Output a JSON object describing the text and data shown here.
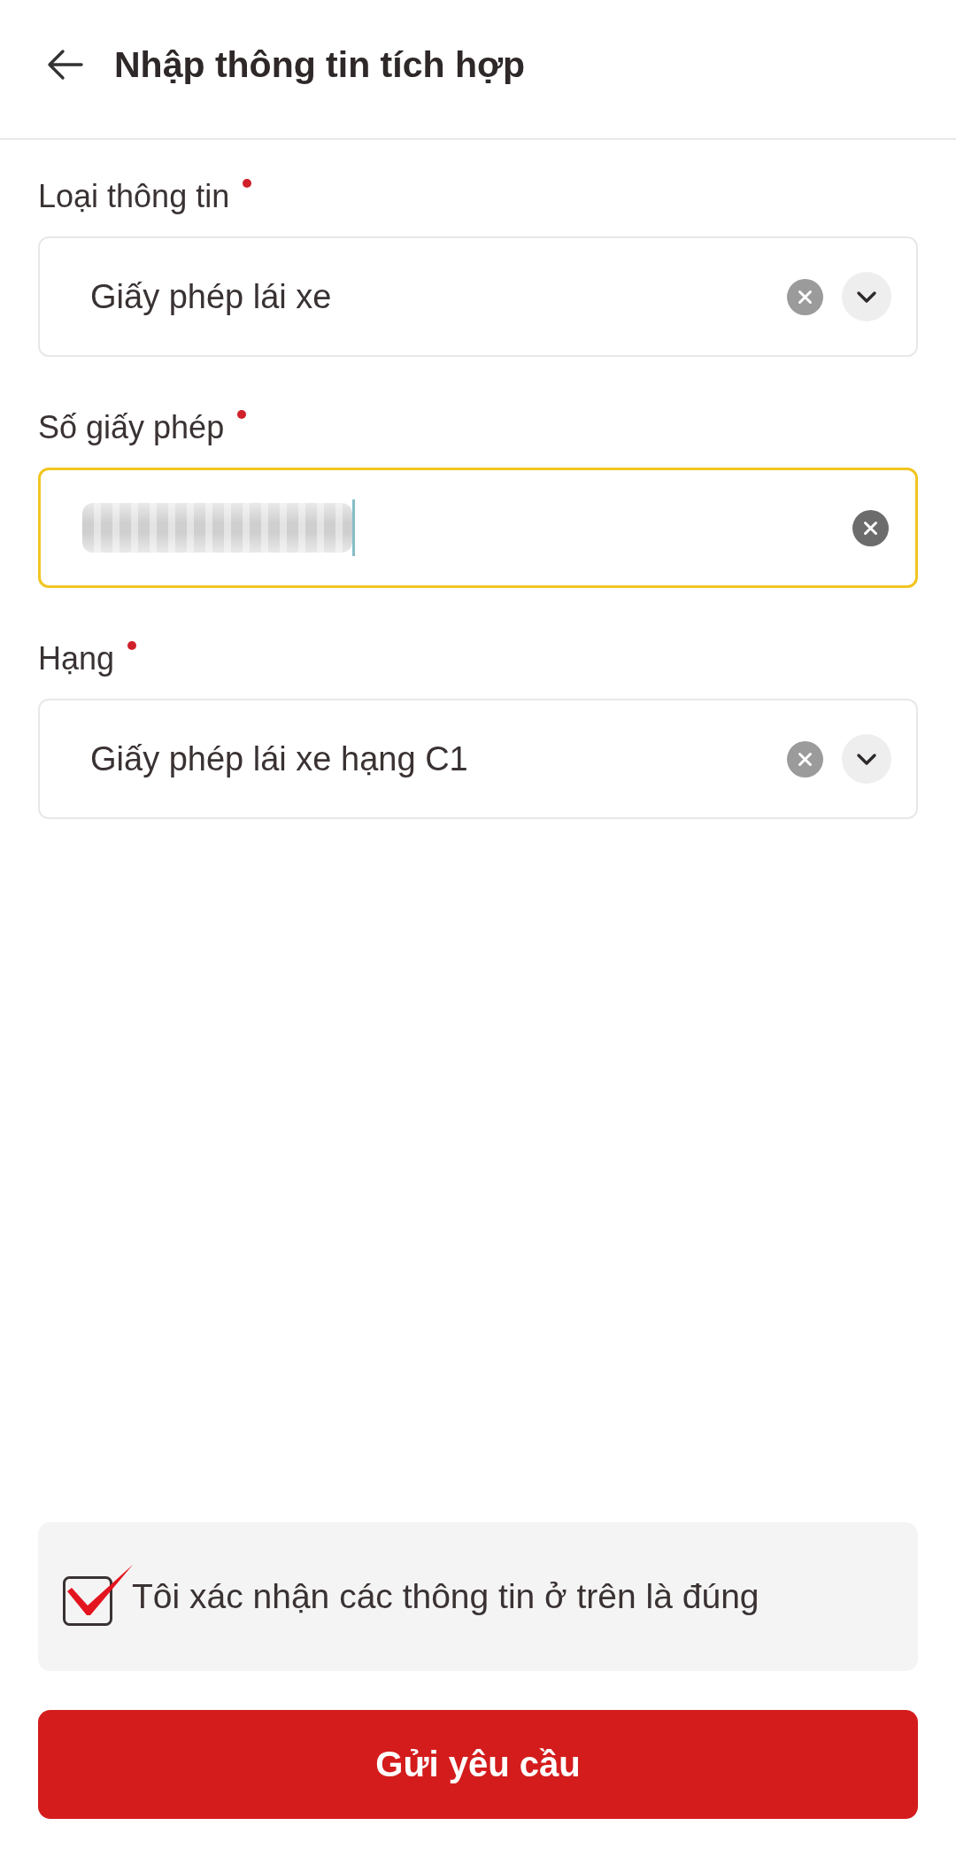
{
  "header": {
    "title": "Nhập thông tin tích hợp"
  },
  "fields": [
    {
      "kind": "select",
      "label": "Loại thông tin",
      "required": true,
      "value": "Giấy phép lái xe",
      "focused": false
    },
    {
      "kind": "text",
      "label": "Số giấy phép",
      "required": true,
      "value_redacted": true,
      "focused": true
    },
    {
      "kind": "select",
      "label": "Hạng",
      "required": true,
      "value": "Giấy phép lái xe hạng C1",
      "focused": false
    }
  ],
  "confirmation": {
    "text": "Tôi xác nhận các thông tin ở trên là đúng",
    "checked": true
  },
  "submit_button": {
    "label": "Gửi yêu cầu"
  }
}
